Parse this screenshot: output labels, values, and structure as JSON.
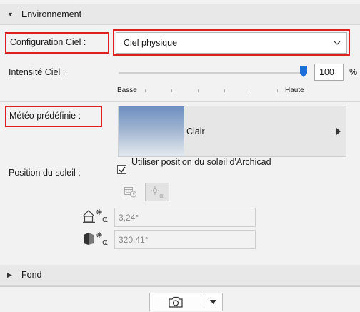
{
  "environment": {
    "title": "Environnement",
    "sky_config": {
      "label": "Configuration Ciel :",
      "value": "Ciel physique"
    },
    "sky_intensity": {
      "label": "Intensité Ciel :",
      "value": "100",
      "unit": "%",
      "fraction": 1.0,
      "min_label": "Basse",
      "max_label": "Haute"
    },
    "weather": {
      "label": "Météo prédéfinie :",
      "preset": "Clair"
    },
    "sun_position": {
      "label": "Position du soleil :",
      "checkbox_label": "Utiliser position du soleil d'Archicad",
      "checked": true,
      "altitude": "3,24°",
      "azimuth": "320,41°"
    }
  },
  "background": {
    "title": "Fond"
  },
  "colors": {
    "accent": "#1e6fd9",
    "highlight": "#e02020"
  }
}
